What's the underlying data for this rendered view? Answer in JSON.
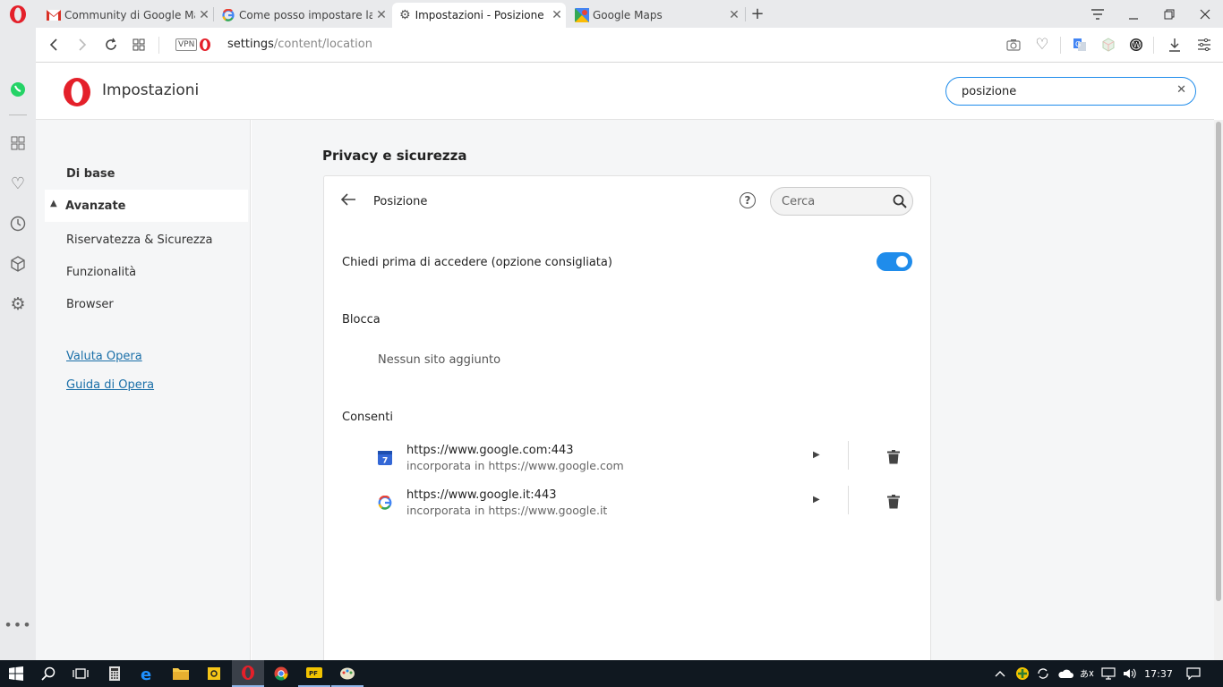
{
  "tabs": [
    {
      "title": "Community di Google Map",
      "favicon": "gmail-icon"
    },
    {
      "title": "Come posso impostare la s",
      "favicon": "google-icon"
    },
    {
      "title": "Impostazioni - Posizione",
      "favicon": "gear-icon"
    },
    {
      "title": "Google Maps",
      "favicon": "google-maps-icon"
    }
  ],
  "address": {
    "vpn_label": "VPN",
    "url_host": "settings",
    "url_path": "/content/location"
  },
  "header": {
    "app_title": "Impostazioni",
    "search_value": "posizione"
  },
  "leftnav": {
    "basic": "Di base",
    "advanced": "Avanzate",
    "items": [
      "Riservatezza & Sicurezza",
      "Funzionalità",
      "Browser"
    ],
    "links": [
      "Valuta Opera",
      "Guida di Opera"
    ]
  },
  "main": {
    "section_title": "Privacy e sicurezza",
    "page_title": "Posizione",
    "search_placeholder": "Cerca",
    "ask_label": "Chiedi prima di accedere (opzione consigliata)",
    "ask_enabled": true,
    "block_label": "Blocca",
    "block_empty": "Nessun sito aggiunto",
    "allow_label": "Consenti",
    "allowed_sites": [
      {
        "url": "https://www.google.com:443",
        "embedded": "incorporata in https://www.google.com",
        "icon": "google-calendar-icon"
      },
      {
        "url": "https://www.google.it:443",
        "embedded": "incorporata in https://www.google.it",
        "icon": "google-icon"
      }
    ]
  },
  "taskbar": {
    "time": "17:37"
  },
  "colors": {
    "accent": "#1f8ceb",
    "opera_red": "#e4202a",
    "link": "#1a6fa8"
  }
}
